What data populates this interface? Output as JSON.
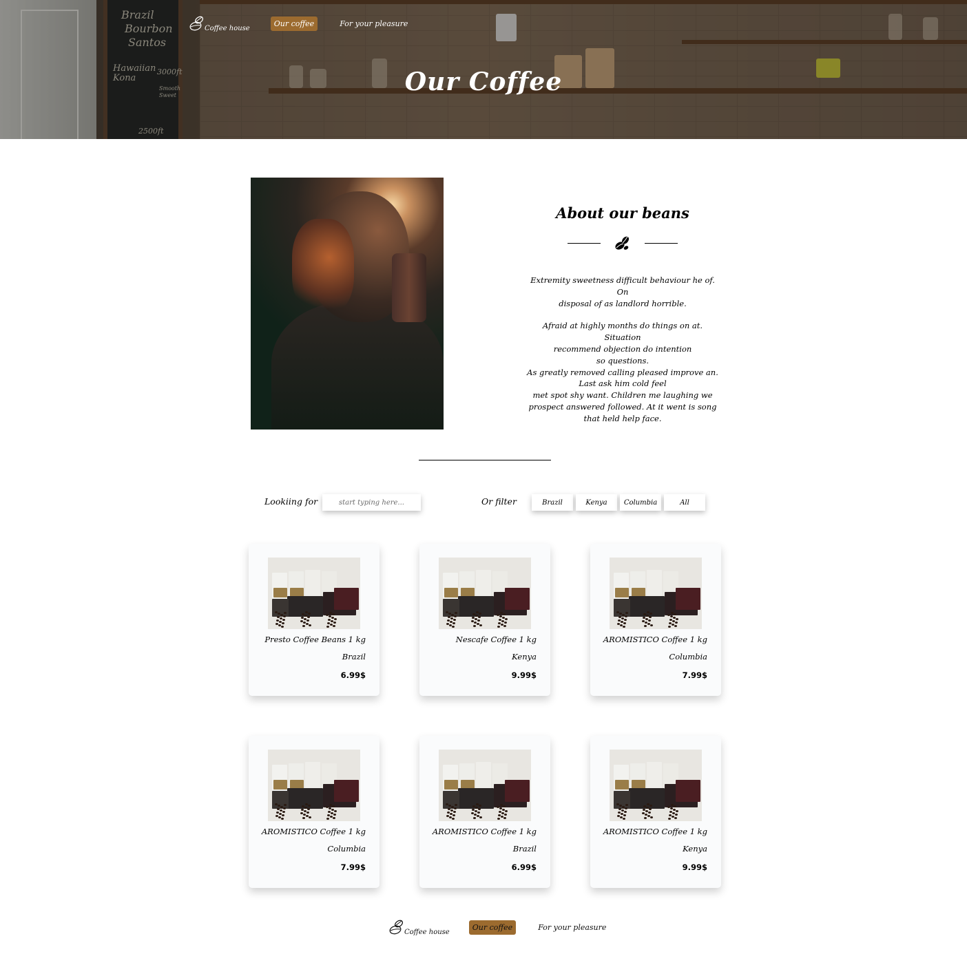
{
  "header": {
    "nav": {
      "logo_text": "Coffee house",
      "links": [
        "Our coffee",
        "For your pleasure"
      ]
    },
    "title": "Our Coffee",
    "chalkboard": [
      "Brazil",
      "Bourbon",
      "Santos",
      "Hawaiian",
      "Kona",
      "3000ft",
      "Smooth",
      "Sweet",
      "2500ft"
    ]
  },
  "about": {
    "title": "About our beans",
    "paragraph1": [
      "Extremity sweetness difficult behaviour he of. On",
      "disposal of as landlord horrible."
    ],
    "paragraph2": [
      "Afraid at highly months do things on at. Situation",
      "recommend objection do intention",
      "so questions.",
      "As greatly removed calling pleased improve an.",
      "Last ask him cold feel",
      "met spot shy want. Children me laughing we",
      "prospect answered followed. At it went is song",
      "that held help face."
    ]
  },
  "filter": {
    "looking_label": "Lookiing for",
    "search_placeholder": "start typing here...",
    "filter_label": "Or filter",
    "buttons": [
      "Brazil",
      "Kenya",
      "Columbia",
      "All"
    ]
  },
  "products": [
    {
      "name": "Presto Coffee Beans 1 kg",
      "country": "Brazil",
      "price": "6.99$"
    },
    {
      "name": "Nescafe Coffee 1 kg",
      "country": "Kenya",
      "price": "9.99$"
    },
    {
      "name": "AROMISTICO Coffee 1 kg",
      "country": "Columbia",
      "price": "7.99$"
    },
    {
      "name": "AROMISTICO Coffee 1 kg",
      "country": "Columbia",
      "price": "7.99$"
    },
    {
      "name": "AROMISTICO Coffee 1 kg",
      "country": "Brazil",
      "price": "6.99$"
    },
    {
      "name": "AROMISTICO Coffee 1 kg",
      "country": "Kenya",
      "price": "9.99$"
    }
  ],
  "footer": {
    "nav": {
      "logo_text": "Coffee house",
      "links": [
        "Our coffee",
        "For your pleasure"
      ]
    }
  },
  "colors": {
    "accent": "#9c6b2f",
    "card_bg": "#fafbfc"
  },
  "icons": [
    "coffee-beans-logo-icon",
    "coffee-beans-icon"
  ]
}
